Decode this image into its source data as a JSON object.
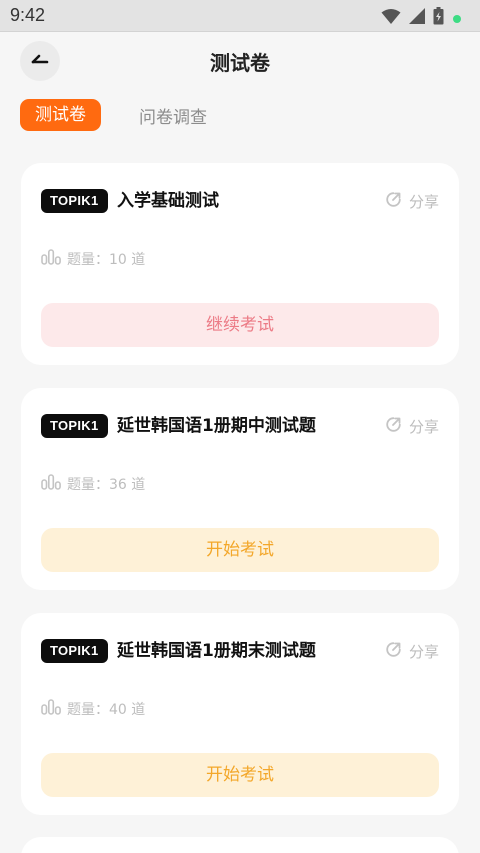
{
  "status_bar": {
    "time": "9:42",
    "icons": [
      "wifi-icon",
      "signal-icon",
      "battery-icon",
      "notification-dot-icon"
    ],
    "dot_color": "#3ddc84"
  },
  "header": {
    "back_icon": "back-arrow-icon",
    "title": "测试卷"
  },
  "tabs": [
    {
      "label": "测试卷",
      "active": true
    },
    {
      "label": "问卷调查",
      "active": false
    }
  ],
  "colors": {
    "accent": "#ff6a10",
    "continue_bg": "#fde9ea",
    "continue_text": "#ec7b86",
    "start_bg": "#fef1d7",
    "start_text": "#f3a72a"
  },
  "papers": [
    {
      "badge": "TOPIK1",
      "title": "入学基础测试",
      "share_label": "分享",
      "question_count": "题量：10 道",
      "action_label": "继续考试",
      "action_state": "continue"
    },
    {
      "badge": "TOPIK1",
      "title": "延世韩国语1册期中测试题",
      "share_label": "分享",
      "question_count": "题量：36 道",
      "action_label": "开始考试",
      "action_state": "start"
    },
    {
      "badge": "TOPIK1",
      "title": "延世韩国语1册期末测试题",
      "share_label": "分享",
      "question_count": "题量：40 道",
      "action_label": "开始考试",
      "action_state": "start"
    }
  ]
}
